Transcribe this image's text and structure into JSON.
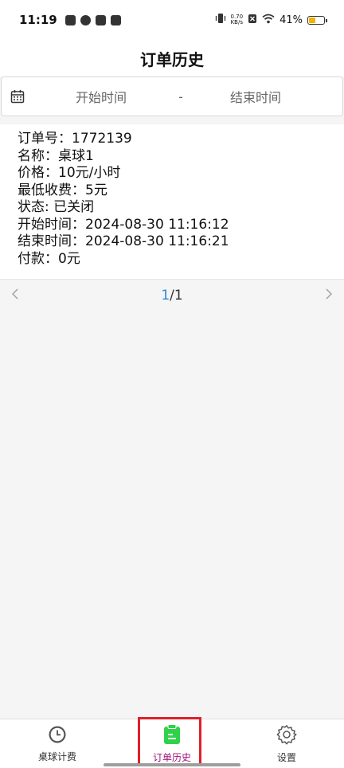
{
  "status_bar": {
    "time": "11:19",
    "net_speed_top": "0.70",
    "net_speed_bottom": "KB/s",
    "battery_pct": "41%",
    "battery_level": 0.41
  },
  "header": {
    "title": "订单历史"
  },
  "date_range": {
    "start_placeholder": "开始时间",
    "separator": "-",
    "end_placeholder": "结束时间"
  },
  "order": {
    "lines": [
      "订单号：1772139",
      "名称：桌球1",
      "价格：10元/小时",
      "最低收费：5元",
      "状态: 已关闭",
      "开始时间：2024-08-30 11:16:12",
      "结束时间：2024-08-30 11:16:21",
      "付款：0元"
    ]
  },
  "pager": {
    "current": "1",
    "total": "/1",
    "prev": "‹",
    "next": "›"
  },
  "bottom_nav": {
    "items": [
      {
        "label": "桌球计费",
        "icon": "clock-icon"
      },
      {
        "label": "订单历史",
        "icon": "clipboard-icon",
        "active": true
      },
      {
        "label": "设置",
        "icon": "gear-icon"
      }
    ]
  },
  "colors": {
    "accent": "#a0147a",
    "active_icon": "#2fd24a",
    "highlight": "#e0202a",
    "page_link": "#2b8bd9"
  }
}
